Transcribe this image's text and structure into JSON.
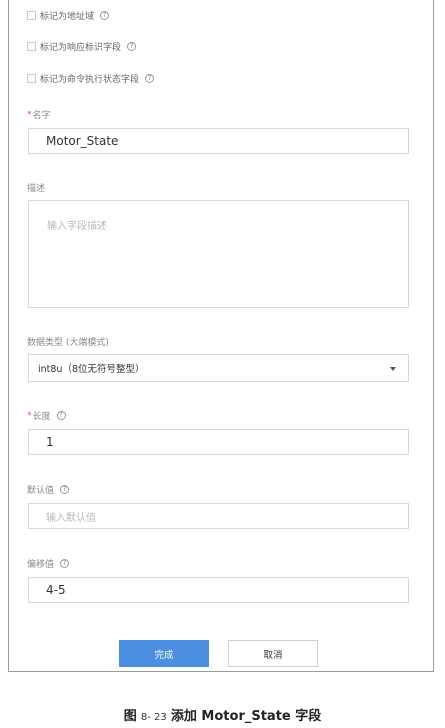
{
  "form": {
    "checkboxes": [
      {
        "label": "标记为地址域",
        "help": "?"
      },
      {
        "label": "标记为响应标识字段",
        "help": "?"
      },
      {
        "label": "标记为命令执行状态字段",
        "help": "?"
      }
    ],
    "name": {
      "required": "*",
      "label": "名字",
      "value": "Motor_State"
    },
    "description": {
      "label": "描述",
      "placeholder": "输入字段描述"
    },
    "data_type": {
      "label": "数据类型 (大端模式)",
      "value": "int8u（8位无符号整型）"
    },
    "length": {
      "required": "*",
      "label": "长度",
      "help": "?",
      "value": "1"
    },
    "default": {
      "label": "默认值",
      "help": "?",
      "placeholder": "输入默认值"
    },
    "offset": {
      "label": "偏移值",
      "help": "?",
      "value": "4-5"
    },
    "buttons": {
      "submit": "完成",
      "cancel": "取消"
    }
  },
  "caption": {
    "fig": "图",
    "num": "8- 23",
    "text": "添加 Motor_State 字段"
  }
}
